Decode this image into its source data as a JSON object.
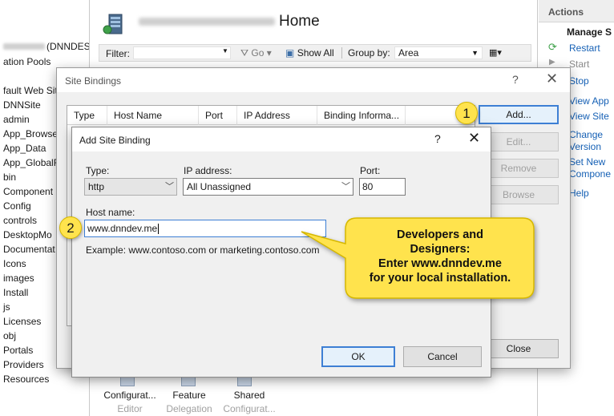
{
  "left_tree": {
    "server_suffix": "(DNNDES",
    "items": [
      "ation Pools",
      "fault Web Site",
      "DNNSite",
      "admin",
      "App_Browse",
      "App_Data",
      "App_GlobalF",
      "bin",
      "Component",
      "Config",
      "controls",
      "DesktopMo",
      "Documentat",
      "Icons",
      "images",
      "Install",
      "js",
      "Licenses",
      "obj",
      "Portals",
      "Providers",
      "Resources"
    ]
  },
  "main": {
    "title": "Home",
    "filter": {
      "label": "Filter:",
      "go_label": "Go",
      "show_all_label": "Show All",
      "group_by_label": "Group by:",
      "group_by_value": "Area"
    },
    "bottom_features": [
      {
        "label": "Configurat...",
        "sub": "Editor"
      },
      {
        "label": "Feature",
        "sub": "Delegation"
      },
      {
        "label": "Shared",
        "sub": "Configurat..."
      }
    ]
  },
  "actions_panel": {
    "header": "Actions",
    "manage": "Manage S",
    "items": [
      "Restart",
      "Start",
      "Stop",
      "View App",
      "View Site",
      "Change",
      "Version",
      "Set New",
      "Compone",
      "Help"
    ]
  },
  "site_bindings": {
    "title": "Site Bindings",
    "help": "?",
    "columns": [
      "Type",
      "Host Name",
      "Port",
      "IP Address",
      "Binding Informa..."
    ],
    "buttons": {
      "add": "Add...",
      "edit": "Edit...",
      "remove": "Remove",
      "browse": "Browse",
      "close": "Close"
    }
  },
  "add_site_binding": {
    "title": "Add Site Binding",
    "help": "?",
    "type_label": "Type:",
    "type_value": "http",
    "ip_label": "IP address:",
    "ip_value": "All Unassigned",
    "port_label": "Port:",
    "port_value": "80",
    "host_label": "Host name:",
    "host_value": "www.dnndev.me",
    "example": "Example: www.contoso.com or marketing.contoso.com",
    "ok": "OK",
    "cancel": "Cancel"
  },
  "annotations": {
    "badge_1": "1",
    "badge_2": "2",
    "callout": "Developers and\nDesigners:\nEnter www.dnndev.me\nfor your local installation."
  },
  "colors": {
    "callout_fill": "#ffe34d",
    "link_blue": "#1560b5",
    "focus_blue": "#3d7fd4"
  }
}
